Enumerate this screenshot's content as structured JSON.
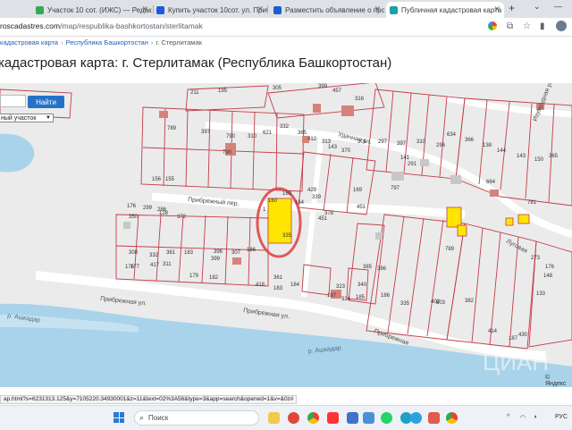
{
  "tabs": [
    {
      "title": "Участок 10 сот. (ИЖС) — Редак",
      "color": "#34a853"
    },
    {
      "title": "Купить участок 10сот. ул. Приб",
      "color": "#1e5bd6"
    },
    {
      "title": "Разместить объявление о прод",
      "color": "#1e5bd6"
    },
    {
      "title": "Публичная кадастровая карта",
      "color": "#19a0a8",
      "active": true
    }
  ],
  "address": {
    "host": "roscadastres.com",
    "path": "/map/respublika-bashkortostan/sterlitamak"
  },
  "breadcrumb": [
    "кадастровая карта",
    "Республика Башкортостан",
    "г. Стерлитамак"
  ],
  "page_title": "кадастровая карта: г. Стерлитамак (Республика Башкортостан)",
  "map": {
    "find_button": "Найти",
    "select_value": "ный участок",
    "attribution": "© Яндекс",
    "streets": [
      "Прибрежный пер.",
      "Прибрежная ул.",
      "Прибрежная ул.",
      "Удачная ул.",
      "Изумрудная ул.",
      "Луговая",
      "Прибрежная",
      "р. Ашкадар",
      "р. Ашкадар"
    ],
    "parcel_numbers": [
      "211",
      "195",
      "305",
      "399",
      "457",
      "316",
      "789",
      "397",
      "790",
      "790",
      "310",
      "621",
      "332",
      "365",
      "412",
      "313",
      "143",
      "370",
      "305",
      "297",
      "397",
      "310",
      "296",
      "634",
      "366",
      "138",
      "144",
      "143",
      "150",
      "365",
      "141",
      "291",
      "664",
      "156",
      "155",
      "429",
      "339",
      "797",
      "176",
      "299",
      "286",
      "160",
      "169",
      "378",
      "781",
      "350",
      "128",
      "372",
      "335",
      "164",
      "451",
      "169",
      "451",
      "789",
      "308",
      "332",
      "381",
      "183",
      "396",
      "307",
      "186",
      "1",
      "176",
      "177",
      "417",
      "311",
      "399",
      "361",
      "179",
      "182",
      "340",
      "385",
      "386",
      "323",
      "324",
      "185",
      "187",
      "186",
      "335",
      "402",
      "418",
      "183",
      "184",
      "803",
      "273",
      "176",
      "430",
      "187",
      "414",
      "382",
      "133",
      "148"
    ],
    "watermark": "ЦИАН"
  },
  "status_url": "ap.html?s=6231313.125&y=7105220.34930001&z=11&text=02%3A56&type=3&app=search&opened=1&v=&0z#",
  "taskbar": {
    "search_placeholder": "Поиск",
    "language": "РУС"
  }
}
